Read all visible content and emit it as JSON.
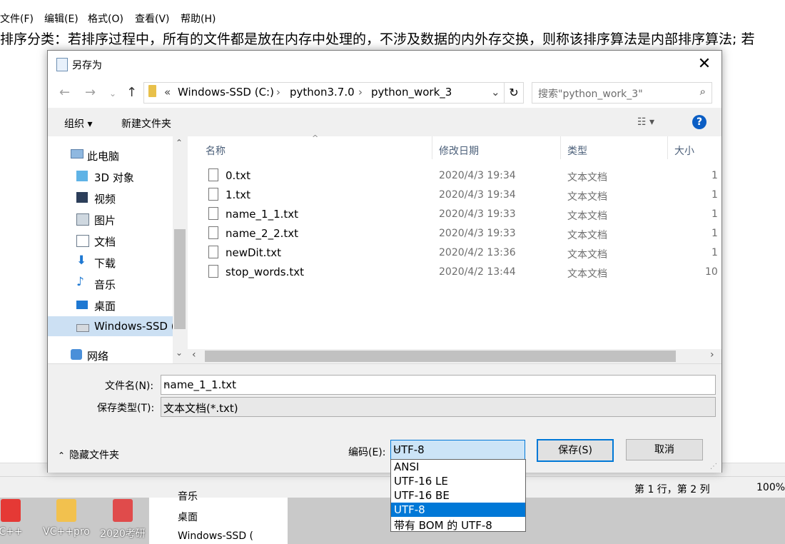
{
  "background": {
    "menu": [
      "文件(F)",
      "编辑(E)",
      "格式(O)",
      "查看(V)",
      "帮助(H)"
    ],
    "text": "排序分类：若排序过程中，所有的文件都是放在内存中处理的，不涉及数据的内外存交换，则称该排序算法是内部排序算法; 若",
    "status_position": "第 1 行，第 2 列",
    "status_zoom": "100%",
    "taskbar": [
      {
        "label": "C++",
        "color": "#e53935"
      },
      {
        "label": "VC++pro",
        "color": "#f2c14e"
      },
      {
        "label": "2020考研",
        "color": "#e04b4b"
      }
    ],
    "explorer_items": [
      "音乐",
      "桌面",
      "Windows-SSD ("
    ]
  },
  "dialog": {
    "title": "另存为",
    "address": {
      "prefix": "«",
      "segments": [
        "Windows-SSD (C:)",
        "python3.7.0",
        "python_work_3"
      ]
    },
    "search_placeholder": "搜索\"python_work_3\"",
    "toolbar": {
      "organize": "组织 ▾",
      "new_folder": "新建文件夹",
      "help": "?"
    },
    "nav": [
      {
        "label": "此电脑",
        "icon": "computer-icon"
      },
      {
        "label": "3D 对象",
        "icon": "cube-icon"
      },
      {
        "label": "视频",
        "icon": "video-icon"
      },
      {
        "label": "图片",
        "icon": "picture-icon"
      },
      {
        "label": "文档",
        "icon": "document-icon"
      },
      {
        "label": "下载",
        "icon": "download-icon"
      },
      {
        "label": "音乐",
        "icon": "music-icon"
      },
      {
        "label": "桌面",
        "icon": "desktop-icon"
      },
      {
        "label": "Windows-SSD (",
        "icon": "drive-icon"
      },
      {
        "label": "网络",
        "icon": "network-icon"
      }
    ],
    "columns": [
      "名称",
      "修改日期",
      "类型",
      "大小"
    ],
    "files": [
      {
        "name": "0.txt",
        "date": "2020/4/3 19:34",
        "type": "文本文档",
        "size": "1"
      },
      {
        "name": "1.txt",
        "date": "2020/4/3 19:34",
        "type": "文本文档",
        "size": "1"
      },
      {
        "name": "name_1_1.txt",
        "date": "2020/4/3 19:33",
        "type": "文本文档",
        "size": "1"
      },
      {
        "name": "name_2_2.txt",
        "date": "2020/4/3 19:33",
        "type": "文本文档",
        "size": "1"
      },
      {
        "name": "newDit.txt",
        "date": "2020/4/2 13:36",
        "type": "文本文档",
        "size": "1"
      },
      {
        "name": "stop_words.txt",
        "date": "2020/4/2 13:44",
        "type": "文本文档",
        "size": "10"
      }
    ],
    "filename_label": "文件名(N):",
    "filename_value": "name_1_1.txt",
    "filetype_label": "保存类型(T):",
    "filetype_value": "文本文档(*.txt)",
    "hide_folders": "隐藏文件夹",
    "encoding_label": "编码(E):",
    "encoding_value": "UTF-8",
    "save_label": "保存(S)",
    "cancel_label": "取消",
    "encoding_options": [
      "ANSI",
      "UTF-16 LE",
      "UTF-16 BE",
      "UTF-8",
      "带有 BOM 的 UTF-8"
    ],
    "encoding_selected_index": 3
  },
  "colors": {
    "accent": "#0078d7",
    "selection": "#cce0f3",
    "help": "#0b5ec4"
  }
}
